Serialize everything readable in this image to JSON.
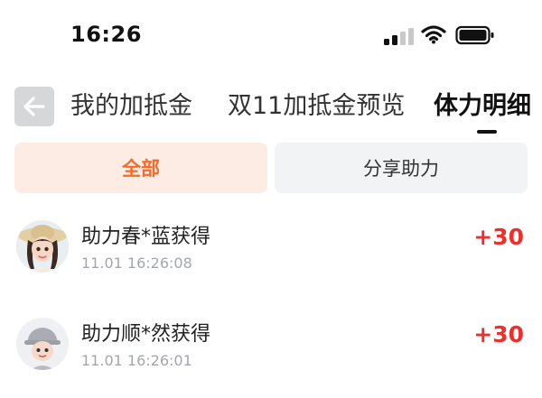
{
  "status_bar": {
    "time": "16:26",
    "icons": [
      "signal-icon",
      "wifi-icon",
      "battery-icon"
    ]
  },
  "header": {
    "back_icon": "arrow-left-icon",
    "tabs": [
      {
        "label": "我的加抵金",
        "active": false
      },
      {
        "label": "双11加抵金预览",
        "active": false
      },
      {
        "label": "体力明细",
        "active": true
      }
    ]
  },
  "filters": {
    "all_label": "全部",
    "share_label": "分享助力",
    "selected": "全部"
  },
  "records": [
    {
      "avatar": "girl-avatar",
      "title": "助力春*蓝获得",
      "time": "11.01 16:26:08",
      "points": "+30"
    },
    {
      "avatar": "boy-avatar",
      "title": "助力顺*然获得",
      "time": "11.01 16:26:01",
      "points": "+30"
    }
  ],
  "colors": {
    "accent_orange": "#f36a2b",
    "active_filter_bg": "#fdece4",
    "inactive_filter_bg": "#f2f3f5",
    "points_red": "#e8322f",
    "timestamp_gray": "#a3a6ab",
    "back_button_bg": "#d6d7d9"
  }
}
